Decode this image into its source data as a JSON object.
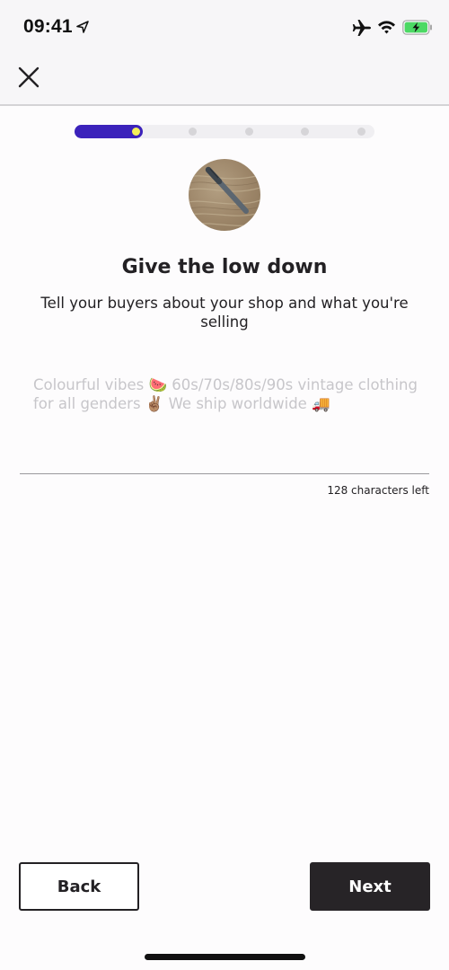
{
  "status_bar": {
    "time": "09:41",
    "icons": [
      "location-arrow-icon",
      "airplane-mode-icon",
      "wifi-icon",
      "battery-charging-icon"
    ],
    "battery_color": "#4cd964"
  },
  "nav": {
    "close_icon": "close-icon"
  },
  "progress": {
    "current_step": 1,
    "total_steps": 5,
    "fill_color": "#3b22bb",
    "knob_color": "#f4ef5a"
  },
  "avatar": {
    "description": "shop photo: pen on wooden surface"
  },
  "header": {
    "title": "Give the low down",
    "subtitle": "Tell your buyers about your shop and what you're selling"
  },
  "description_field": {
    "value": "",
    "placeholder": "Colourful vibes 🍉 60s/70s/80s/90s vintage clothing for all genders ✌🏽 We ship worldwide 🚚",
    "characters_left": "128 characters left"
  },
  "buttons": {
    "back_label": "Back",
    "next_label": "Next"
  }
}
